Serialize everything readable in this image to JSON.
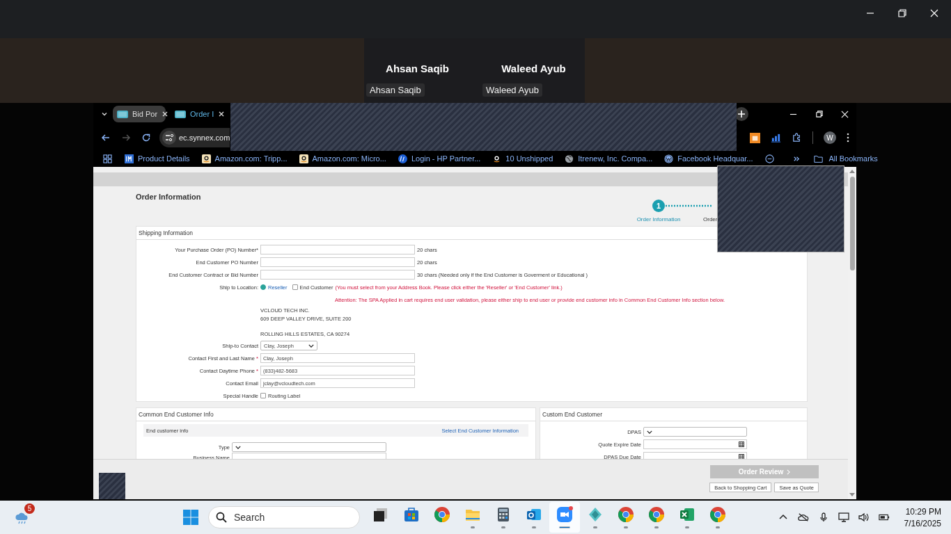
{
  "meeting": {
    "participants": [
      {
        "name": "Ahsan Saqib",
        "tag": "Ahsan Saqib"
      },
      {
        "name": "Waleed Ayub",
        "tag": "Waleed Ayub"
      }
    ]
  },
  "browser": {
    "tabs": [
      {
        "title": "Bid Por",
        "selected": true
      },
      {
        "title": "Order I",
        "selected": false
      }
    ],
    "address": "ec.synnex.com",
    "profile": "W",
    "bookmarks": [
      {
        "kind": "im",
        "label": "Product Details"
      },
      {
        "kind": "amazon",
        "label": "Amazon.com: Tripp..."
      },
      {
        "kind": "amazon",
        "label": "Amazon.com: Micro..."
      },
      {
        "kind": "hp",
        "label": "Login - HP Partner..."
      },
      {
        "kind": "amazon-plain",
        "label": "10 Unshipped"
      },
      {
        "kind": "globe",
        "label": "Itrenew, Inc. Compa..."
      },
      {
        "kind": "wordpress",
        "label": "Facebook Headquar..."
      },
      {
        "kind": "ring"
      }
    ],
    "all_bookmarks": "All Bookmarks"
  },
  "page": {
    "title": "Order Information",
    "steps": [
      {
        "number": "1",
        "label": "Order Information",
        "selected": true
      },
      {
        "label": "Order"
      }
    ],
    "shipping": {
      "title": "Shipping Information",
      "rows": [
        {
          "kind": "input",
          "label": "Your Purchase Order (PO) Number*",
          "hint": "20 chars"
        },
        {
          "kind": "input",
          "label": "End Customer PO Number",
          "hint": "20 chars"
        },
        {
          "kind": "input",
          "label": "End Customer Contract or Bid Number",
          "hint": "30 chars (Needed only if the End Customer is Goverment or Educational )"
        },
        {
          "kind": "radio",
          "label": "Ship to Location:",
          "options": [
            {
              "label": "Reseller",
              "selected": true
            },
            {
              "label": "End Customer",
              "selected": false
            }
          ],
          "note": "(You must select from your Address Book. Please click either the 'Reseller' or 'End Customer' link.)"
        },
        {
          "kind": "attention",
          "text": "Attention: The SPA Applied in cart requires end user validation, please either ship to end user or provide end customer info in Common End Customer Info section below."
        },
        {
          "kind": "address",
          "lines": [
            "VCLOUD TECH INC.",
            "609 DEEP VALLEY DRIVE, SUITE 200"
          ],
          "city_line": "ROLLING HILLS ESTATES, CA 90274"
        },
        {
          "kind": "select",
          "label": "Ship-to Contact",
          "value": "Clay, Joseph"
        },
        {
          "kind": "input",
          "label": "Contact First and Last Name",
          "required_mark": "*",
          "value": "Clay, Joseph"
        },
        {
          "kind": "input",
          "label": "Contact Daytime Phone",
          "required_mark": "*",
          "value": "(833)482-5683"
        },
        {
          "kind": "input",
          "label": "Contact Email",
          "value": "jclay@vcloudtech.com"
        },
        {
          "kind": "checkbox",
          "label": "Special Handle",
          "option": "Routing Label",
          "checked": false
        }
      ]
    },
    "common": {
      "title": "Common End Customer Info",
      "subtitle": "End customer info",
      "link": "Select End Customer Information",
      "rows": [
        {
          "kind": "select",
          "label": "Type"
        },
        {
          "kind": "input",
          "label": "Business Name"
        }
      ]
    },
    "custom": {
      "title": "Custom End Customer",
      "rows": [
        {
          "kind": "select",
          "label": "DPAS"
        },
        {
          "kind": "date",
          "label": "Quote Expire Date"
        },
        {
          "kind": "date",
          "label": "DPAS Due Date"
        }
      ]
    },
    "footer": {
      "primary": {
        "label": "Order Review",
        "disabled": true
      },
      "buttons": [
        "Back to Shopping Cart",
        "Save as Quote"
      ]
    }
  },
  "taskbar": {
    "weather_badge": "5",
    "search": "Search",
    "apps": [
      {
        "kind": "taskview",
        "running": false,
        "selected": false
      },
      {
        "kind": "store",
        "running": false,
        "selected": false
      },
      {
        "kind": "chrome",
        "running": false,
        "selected": false
      },
      {
        "kind": "files",
        "running": true,
        "selected": false
      },
      {
        "kind": "calculator",
        "running": true,
        "selected": false
      },
      {
        "kind": "outlook",
        "running": true,
        "selected": false
      },
      {
        "kind": "zoom",
        "running": true,
        "selected": true
      },
      {
        "kind": "gem",
        "running": true,
        "selected": false
      },
      {
        "kind": "chrome",
        "running": true,
        "selected": false
      },
      {
        "kind": "chrome",
        "running": true,
        "selected": false
      },
      {
        "kind": "excel",
        "running": true,
        "selected": false
      },
      {
        "kind": "chrome",
        "running": true,
        "selected": false
      }
    ],
    "time": "10:29 PM",
    "date": "7/16/2025"
  }
}
